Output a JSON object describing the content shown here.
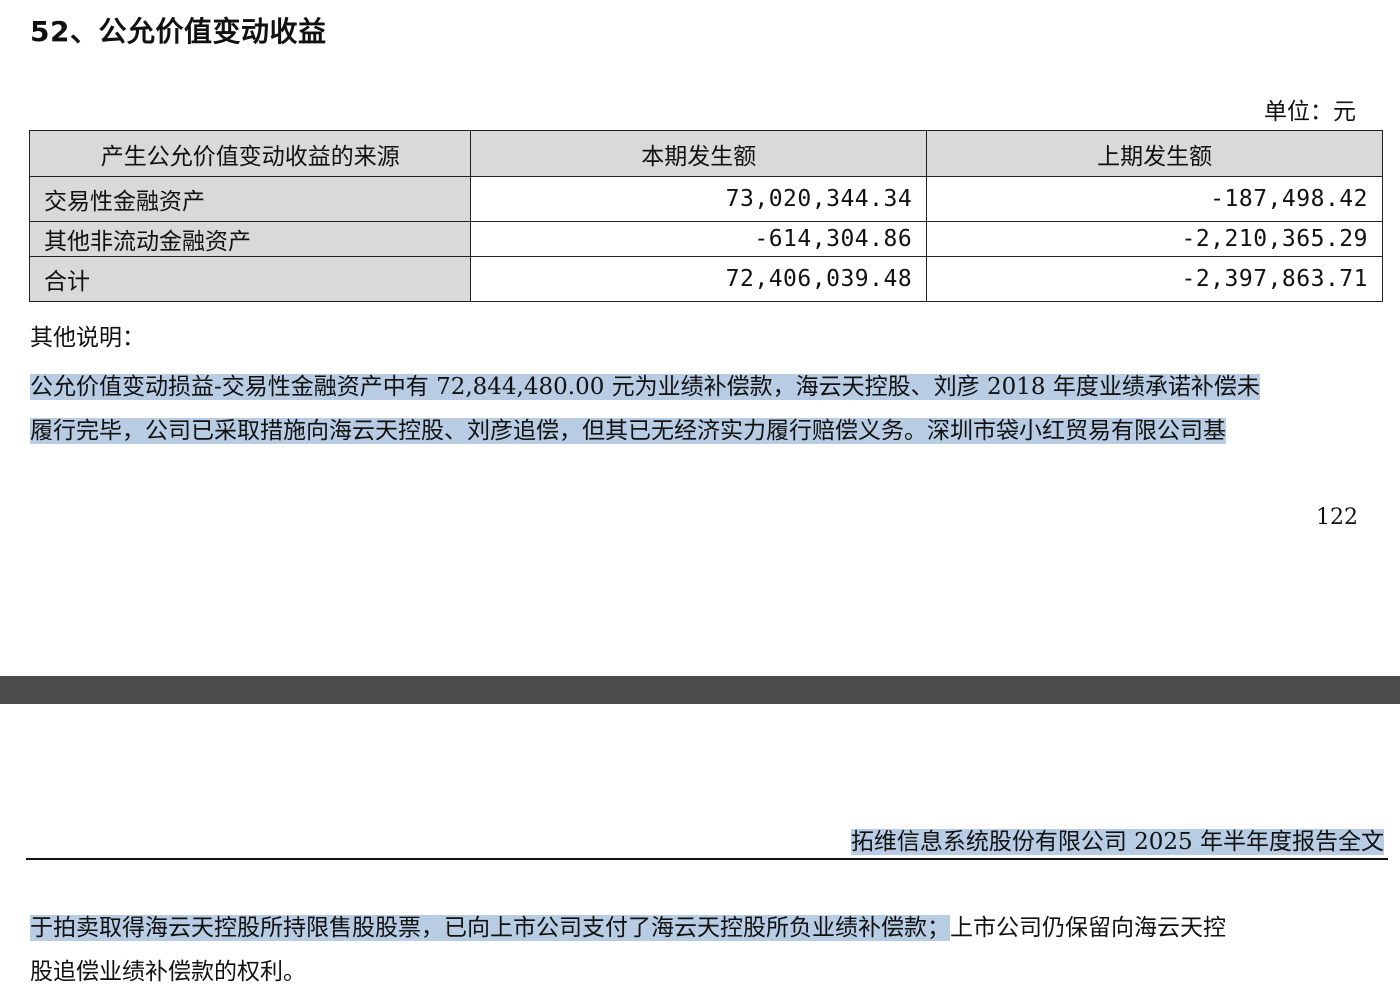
{
  "section": {
    "title": "52、公允价值变动收益",
    "unit": "单位：元"
  },
  "table": {
    "headers": [
      "产生公允价值变动收益的来源",
      "本期发生额",
      "上期发生额"
    ],
    "rows": [
      {
        "label": "交易性金融资产",
        "current": "73,020,344.34",
        "prior": "-187,498.42"
      },
      {
        "label": "其他非流动金融资产",
        "current": "-614,304.86",
        "prior": "-2,210,365.29"
      },
      {
        "label": "合计",
        "current": "72,406,039.48",
        "prior": "-2,397,863.71"
      }
    ]
  },
  "notes": {
    "label": "其他说明：",
    "para1_line1": "公允价值变动损益-交易性金融资产中有 72,844,480.00 元为业绩补偿款，海云天控股、刘彦 2018 年度业绩承诺补偿未",
    "para1_line2": "履行完毕，公司已采取措施向海云天控股、刘彦追偿，但其已无经济实力履行赔偿义务。深圳市袋小红贸易有限公司基",
    "para2_line1_highlighted": "于拍卖取得海云天控股所持限售股股票，已向上市公司支付了海云天控股所负业绩补偿款；",
    "para2_line1_rest": "上市公司仍保留向海云天控",
    "para2_line2": "股追偿业绩补偿款的权利。"
  },
  "page": {
    "number": "122",
    "report_header": "拓维信息系统股份有限公司 2025 年半年度报告全文"
  },
  "colors": {
    "table_header_bg": "#d9d9d9",
    "highlight": "#b8cde3",
    "page_divider": "#4a4b4d"
  }
}
